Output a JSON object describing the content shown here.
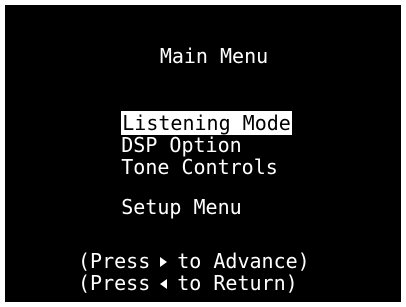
{
  "menu": {
    "title": "Main Menu",
    "items": [
      {
        "label": "Listening Mode",
        "selected": true
      },
      {
        "label": "DSP Option",
        "selected": false
      },
      {
        "label": "Tone Controls",
        "selected": false
      },
      {
        "label": "Setup Menu",
        "selected": false
      }
    ]
  },
  "hints": {
    "advance_prefix": "(Press",
    "advance_suffix": "to Advance)",
    "advance_icon": "right-triangle-icon",
    "return_prefix": "(Press",
    "return_suffix": "to Return)",
    "return_icon": "left-triangle-icon"
  },
  "colors": {
    "background": "#000000",
    "text": "#ffffff",
    "highlight_bg": "#ffffff",
    "highlight_text": "#000000"
  }
}
